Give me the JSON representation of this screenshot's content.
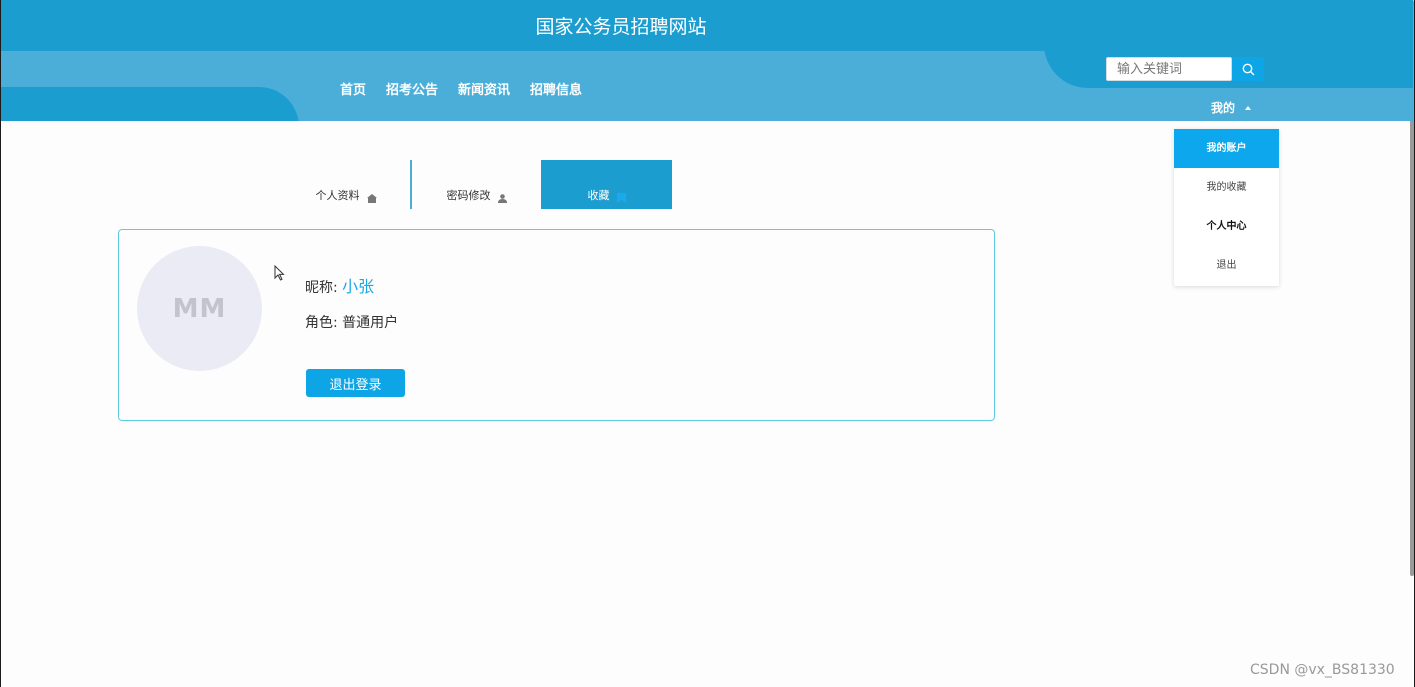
{
  "header": {
    "site_title": "国家公务员招聘网站",
    "nav": [
      "首页",
      "招考公告",
      "新闻资讯",
      "招聘信息"
    ],
    "search_placeholder": "输入关键词",
    "my_label": "我的"
  },
  "dropdown": {
    "items": [
      "我的账户",
      "我的收藏",
      "个人中心",
      "退出"
    ],
    "active_index": 0
  },
  "tabs": {
    "items": [
      "个人资料",
      "密码修改",
      "收藏"
    ],
    "active_index": 2
  },
  "profile": {
    "avatar_text": "MM",
    "nickname_label": "昵称:",
    "nickname_value": "小张",
    "role_label": "角色:",
    "role_value": "普通用户",
    "logout_button": "退出登录"
  },
  "watermark": "CSDN @vx_BS81330",
  "colors": {
    "header_dark": "#1b9dd0",
    "header_light": "#4aaed9",
    "accent": "#0ea5e6",
    "card_border": "#5fcbe0"
  }
}
